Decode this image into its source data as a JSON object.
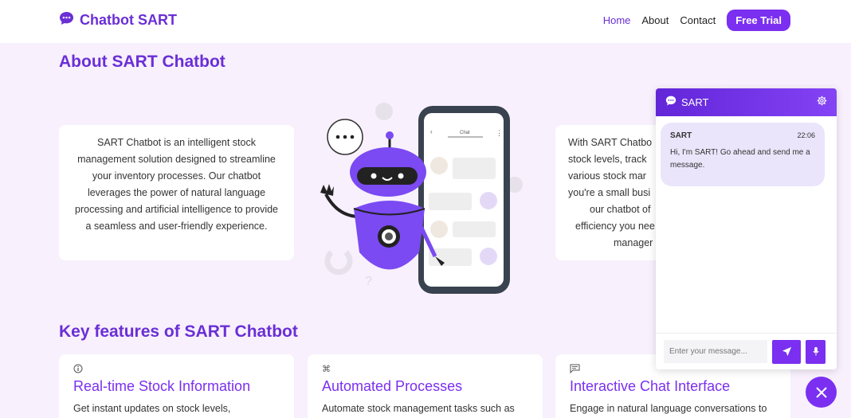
{
  "navbar": {
    "brand": "Chatbot SART",
    "links": [
      {
        "label": "Home",
        "active": true
      },
      {
        "label": "About",
        "active": false
      },
      {
        "label": "Contact",
        "active": false
      }
    ],
    "cta": "Free Trial"
  },
  "about": {
    "title": "About SART Chatbot",
    "left_text": "SART Chatbot is an intelligent stock management solution designed to streamline your inventory processes. Our chatbot leverages the power of natural language processing and artificial intelligence to provide a seamless and user-friendly experience.",
    "right_lines": [
      "With SART Chatbo",
      "stock levels, track",
      "various stock mar",
      "you're a small busi",
      "our chatbot of",
      "efficiency you nee",
      "manager"
    ],
    "illustration": {
      "phone_header": "Chat"
    }
  },
  "features": {
    "title": "Key features of SART Chatbot",
    "items": [
      {
        "icon": "info-icon",
        "title": "Real-time Stock Information",
        "desc": "Get instant updates on stock levels,"
      },
      {
        "icon": "command-icon",
        "title": "Automated Processes",
        "desc": "Automate stock management tasks such as"
      },
      {
        "icon": "chat-text-icon",
        "title": "Interactive Chat Interface",
        "desc": "Engage in natural language conversations to"
      }
    ]
  },
  "chat": {
    "header_title": "SART",
    "message": {
      "sender": "SART",
      "time": "22:06",
      "text": "Hi, I'm SART! Go ahead and send me a message."
    },
    "input_placeholder": "Enter your message..."
  },
  "colors": {
    "accent": "#7b2ff0",
    "brand": "#6a2fd6",
    "background": "#f8f0fd"
  }
}
